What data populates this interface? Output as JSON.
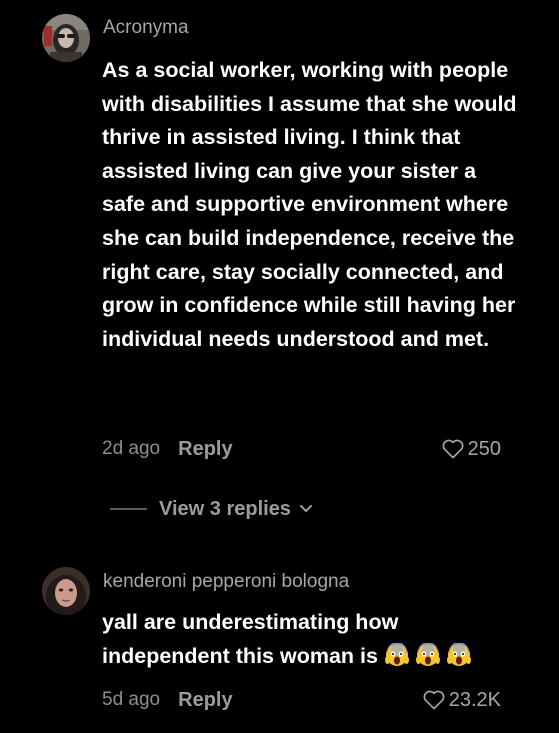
{
  "comments": [
    {
      "username": "Acronyma",
      "text": "As a social worker, working with people with disabilities I assume that she would thrive in assisted living. I think that assisted living can give your sister a safe and supportive environment where she can build independence, receive the right care, stay socially connected, and grow in confidence while still having her individual needs understood and met.",
      "time": "2d ago",
      "reply_label": "Reply",
      "likes": "250",
      "view_replies": "View 3 replies"
    },
    {
      "username": "kenderoni pepperoni bologna",
      "text": "yall are underestimating how independent this woman is",
      "emojis": [
        "screaming-face",
        "screaming-face",
        "screaming-face"
      ],
      "time": "5d ago",
      "reply_label": "Reply",
      "likes": "23.2K"
    }
  ],
  "colors": {
    "background": "#000000",
    "text": "#ffffff",
    "muted": "#a6a6a6"
  }
}
